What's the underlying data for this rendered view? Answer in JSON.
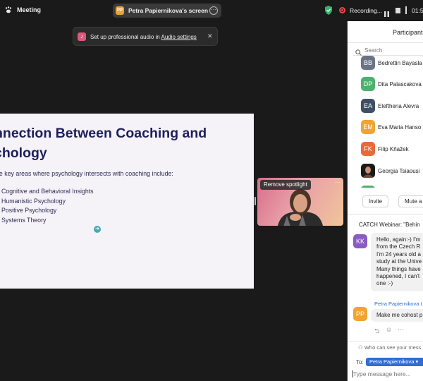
{
  "topbar": {
    "app_title": "Meeting",
    "share_avatar": "PP",
    "share_label": "Petra Papiernikova's screen",
    "recording_label": "Recording...",
    "timer": "01:5"
  },
  "notice": {
    "text": "Set up professional audio in ",
    "link": "Audio settings"
  },
  "slide": {
    "title": "nnection Between Coaching and\nchology",
    "intro": "he key areas where psychology intersects with coaching include:",
    "items": [
      "Cognitive and Behavioral Insights",
      "Humanistic Psychology",
      "Positive Psychology",
      "Systems Theory"
    ]
  },
  "video": {
    "spotlight_label": "Remove spotlight"
  },
  "sidebar": {
    "title": "Participants",
    "search_placeholder": "Search",
    "participants": [
      {
        "initials": "BB",
        "name": "Bedrettin Bayasla",
        "color": "#6b7486"
      },
      {
        "initials": "DP",
        "name": "Dita Palascakova",
        "color": "#4cb26d"
      },
      {
        "initials": "EA",
        "name": "Eleftheria Alevra",
        "color": "#3f5164"
      },
      {
        "initials": "EM",
        "name": "Eva Maria Hanso",
        "color": "#f0a431"
      },
      {
        "initials": "FK",
        "name": "Filip Kňažek",
        "color": "#e86a3a"
      },
      {
        "initials": "",
        "name": "Georgia Tsiaousi",
        "color": "#1a1a1a"
      }
    ],
    "invite_label": "Invite",
    "mute_label": "Mute a"
  },
  "chat": {
    "title": "CATCH Webinar: \"Behin",
    "msg1": {
      "initials": "KK",
      "lines": [
        "Hello, again:-) I'm",
        "from the Czech R",
        "I'm 24 years old a",
        "study at the Unive",
        "Many things have",
        "happened, I can't",
        "one :-)"
      ]
    },
    "msg2": {
      "sender": "Petra Papiernikova",
      "to": " t",
      "initials": "PP",
      "text": "Make me cohost p"
    },
    "visibility": "Who can see your mess",
    "to_label": "To:",
    "to_value": "Petra Papiernikova",
    "input_placeholder": "Type message here..."
  },
  "colors": {
    "slide_title": "#1d1f5e",
    "link_blue": "#2d6fd3",
    "recording_red": "#e94b4b"
  }
}
